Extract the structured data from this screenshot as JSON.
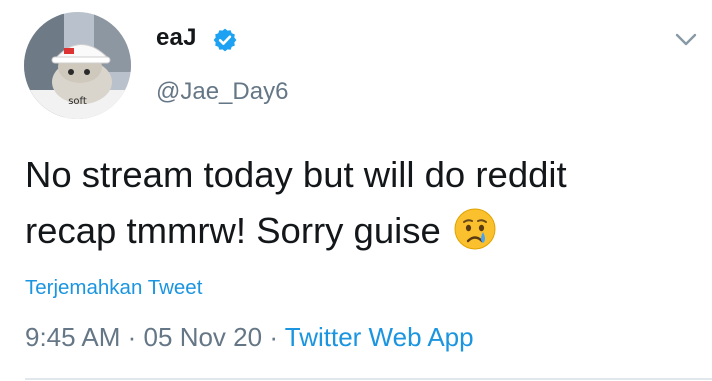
{
  "user": {
    "display_name": "eaJ",
    "handle": "@Jae_Day6",
    "verified": true,
    "avatar_caption": "soft"
  },
  "tweet": {
    "text_line1": "No stream today but will do reddit",
    "text_line2": "recap tmmrw! Sorry guise",
    "emoji": "crying-face-emoji",
    "translate_label": "Terjemahkan Tweet",
    "time": "9:45 AM",
    "separator": "·",
    "date": "05 Nov 20",
    "source": "Twitter Web App"
  },
  "colors": {
    "link": "#1b95e0",
    "secondary_text": "#657786",
    "primary_text": "#14171a"
  },
  "icons": {
    "verified": "verified-badge-icon",
    "menu": "chevron-down-icon"
  }
}
